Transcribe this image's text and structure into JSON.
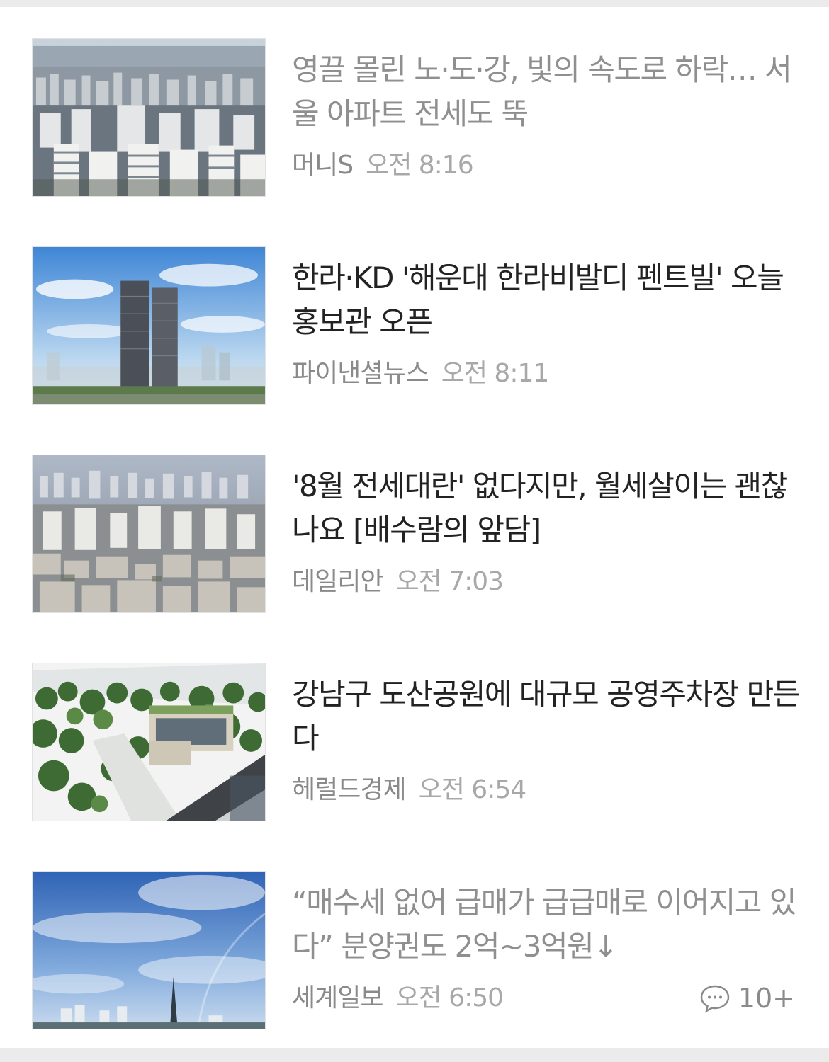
{
  "articles": [
    {
      "title": "영끌 몰린 노·도·강, 빛의 속도로 하락… 서울 아파트 전세도 뚝",
      "source": "머니S",
      "time": "오전 8:16",
      "read": true,
      "image": "apartment-cityscape"
    },
    {
      "title": "한라·KD '해운대 한라비발디 펜트빌' 오늘 홍보관 오픈",
      "source": "파이낸셜뉴스",
      "time": "오전 8:11",
      "read": false,
      "image": "twin-towers-rendering"
    },
    {
      "title": "'8월 전세대란' 없다지만, 월세살이는 괜찮나요 [배수람의 앞담]",
      "source": "데일리안",
      "time": "오전 7:03",
      "read": false,
      "image": "dense-residential-district"
    },
    {
      "title": "강남구 도산공원에 대규모 공영주차장 만든다",
      "source": "헤럴드경제",
      "time": "오전 6:54",
      "read": false,
      "image": "park-parking-rendering"
    },
    {
      "title": "“매수세 없어 급매가 급급매로 이어지고 있다” 분양권도 2억~3억원↓",
      "source": "세계일보",
      "time": "오전 6:50",
      "read": true,
      "image": "sky-skyline",
      "comment_count": "10+"
    }
  ],
  "colors": {
    "title": "#222222",
    "title_read": "#8f8f8f",
    "meta": "#9a9a9a",
    "separator": "#ebebeb"
  }
}
